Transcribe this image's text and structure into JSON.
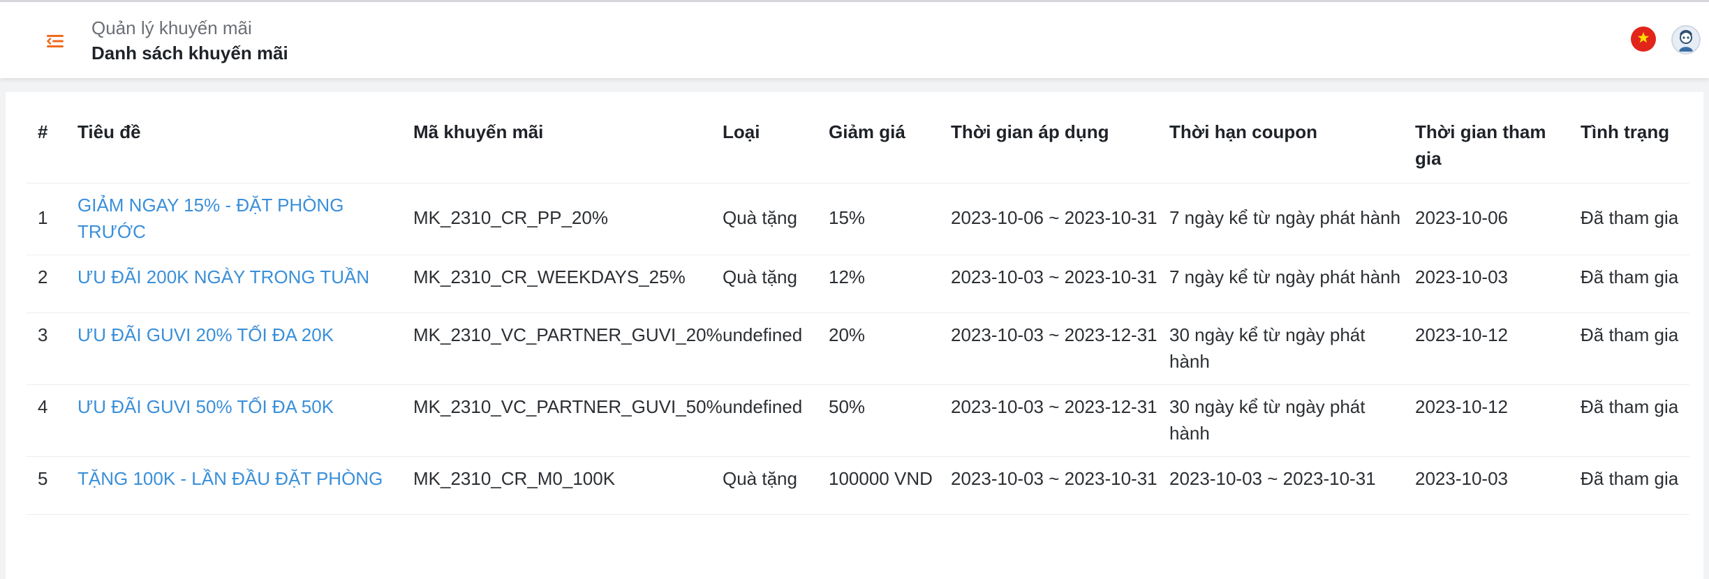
{
  "header": {
    "parent": "Quản lý khuyến mãi",
    "current": "Danh sách khuyến mãi"
  },
  "colors": {
    "accent": "#f06a1d",
    "link": "#3a8fd9",
    "flag": "#e1251b"
  },
  "icons": {
    "menu": "menu-collapse-icon",
    "flag": "vietnam-flag-icon",
    "avatar": "user-avatar"
  },
  "table": {
    "columns": [
      "#",
      "Tiêu đề",
      "Mã khuyến mãi",
      "Loại",
      "Giảm giá",
      "Thời gian áp dụng",
      "Thời hạn coupon",
      "Thời gian tham gia",
      "Tình trạng"
    ],
    "rows": [
      {
        "no": "1",
        "title": "GIẢM NGAY 15% - ĐẶT PHÒNG TRƯỚC",
        "code": "MK_2310_CR_PP_20%",
        "type": "Quà tặng",
        "discount": "15%",
        "period": "2023-10-06 ~ 2023-10-31",
        "coupon": "7 ngày kể từ ngày phát hành",
        "joined": "2023-10-06",
        "status": "Đã tham gia"
      },
      {
        "no": "2",
        "title": "ƯU ĐÃI 200K NGÀY TRONG TUẦN",
        "code": "MK_2310_CR_WEEKDAYS_25%",
        "type": "Quà tặng",
        "discount": "12%",
        "period": "2023-10-03 ~ 2023-10-31",
        "coupon": "7 ngày kể từ ngày phát hành",
        "joined": "2023-10-03",
        "status": "Đã tham gia"
      },
      {
        "no": "3",
        "title": "ƯU ĐÃI GUVI 20% TỐI ĐA 20K",
        "code": "MK_2310_VC_PARTNER_GUVI_20%",
        "type": "undefined",
        "discount": "20%",
        "period": "2023-10-03 ~ 2023-12-31",
        "coupon": "30 ngày kể từ ngày phát hành",
        "joined": "2023-10-12",
        "status": "Đã tham gia"
      },
      {
        "no": "4",
        "title": "ƯU ĐÃI GUVI 50% TỐI ĐA 50K",
        "code": "MK_2310_VC_PARTNER_GUVI_50%",
        "type": "undefined",
        "discount": "50%",
        "period": "2023-10-03 ~ 2023-12-31",
        "coupon": "30 ngày kể từ ngày phát hành",
        "joined": "2023-10-12",
        "status": "Đã tham gia"
      },
      {
        "no": "5",
        "title": "TẶNG 100K - LẦN ĐẦU ĐẶT PHÒNG",
        "code": "MK_2310_CR_M0_100K",
        "type": "Quà tặng",
        "discount": "100000 VND",
        "period": "2023-10-03 ~ 2023-10-31",
        "coupon": "2023-10-03 ~ 2023-10-31",
        "joined": "2023-10-03",
        "status": "Đã tham gia"
      }
    ]
  }
}
